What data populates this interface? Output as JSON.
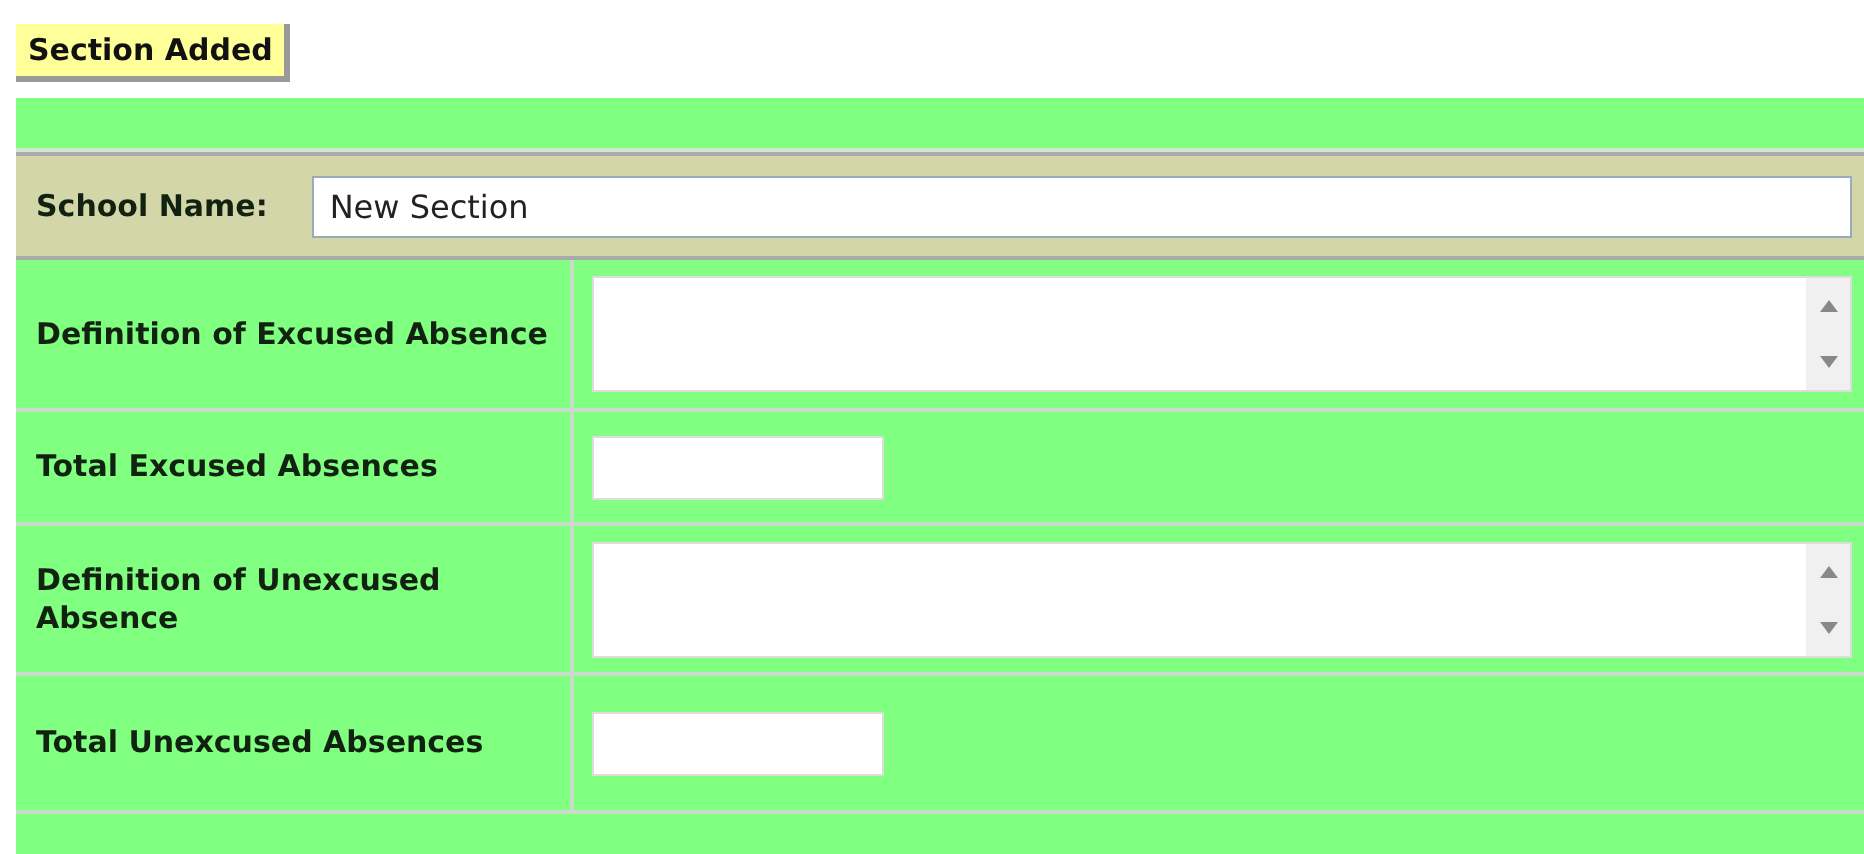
{
  "status_button": {
    "label": "Section Added"
  },
  "school_name": {
    "label": "School Name:",
    "value": "New Section"
  },
  "fields": [
    {
      "label": "Definition of Excused Absence",
      "kind": "textarea"
    },
    {
      "label": "Total Excused Absences",
      "kind": "text"
    },
    {
      "label": "Definition of Unexcused Absence",
      "kind": "textarea"
    },
    {
      "label": "Total Unexcused Absences",
      "kind": "text"
    }
  ]
}
